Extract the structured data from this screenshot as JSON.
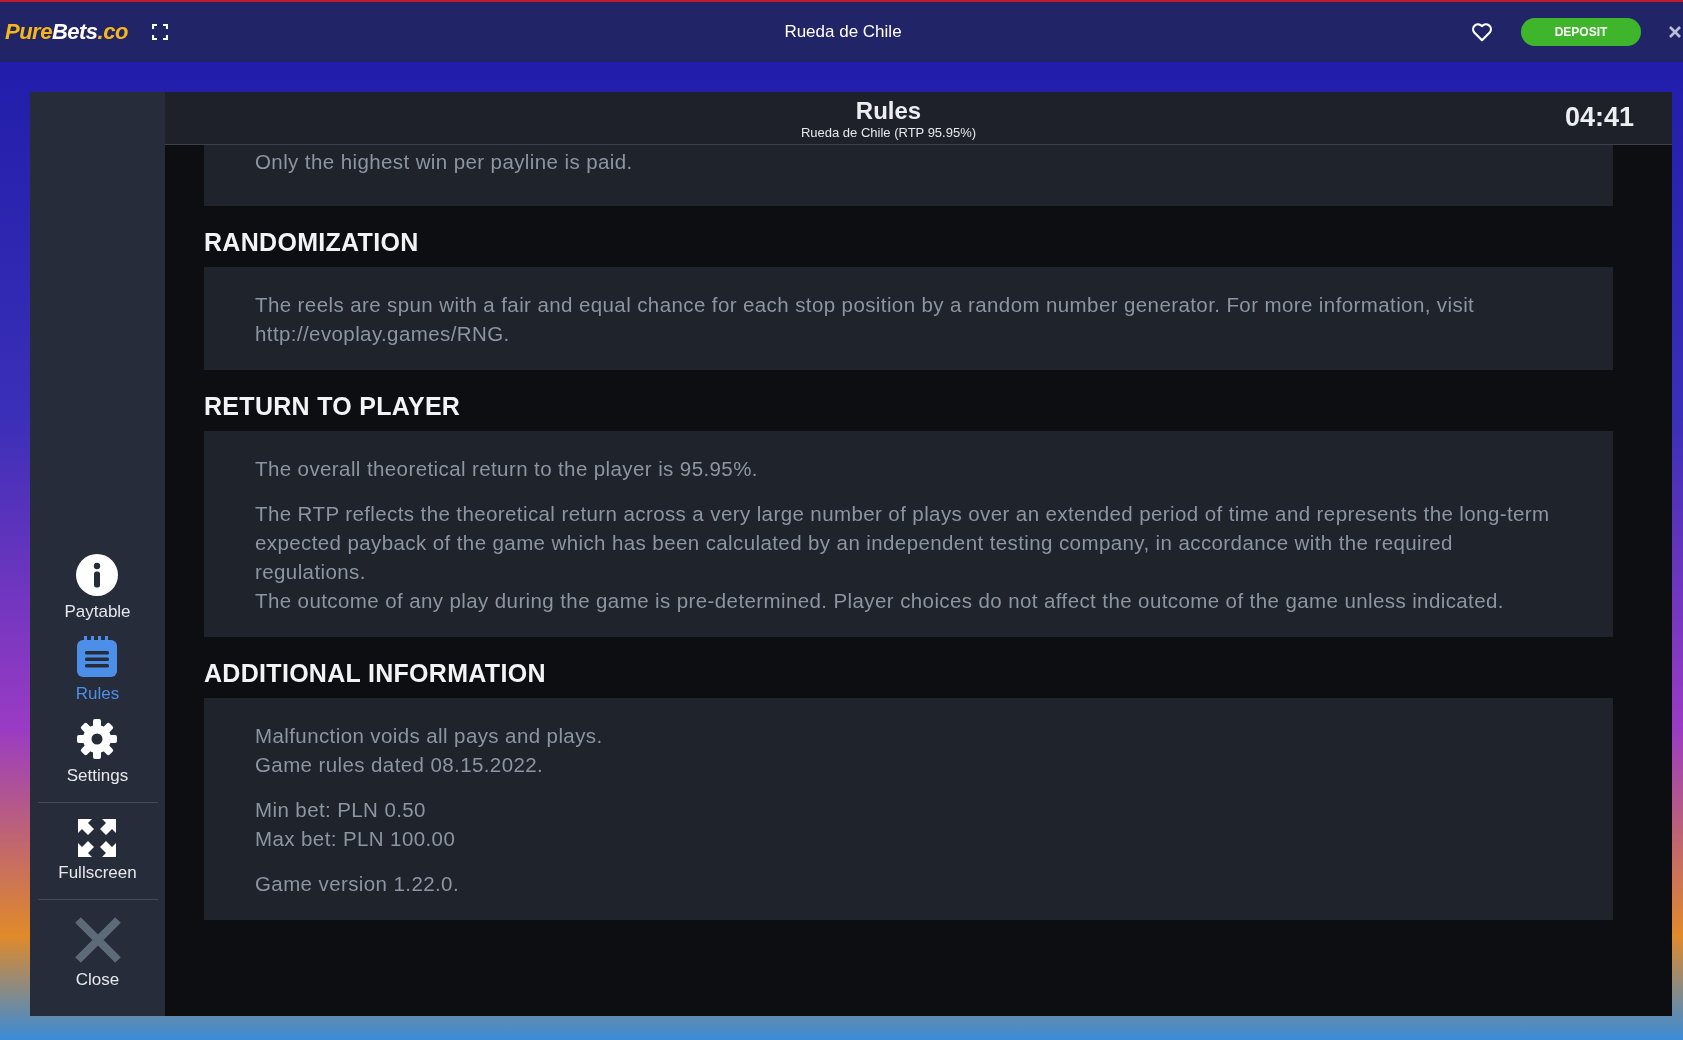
{
  "top_bar": {
    "logo": [
      "Pure",
      "Bets",
      ".co"
    ],
    "title": "Rueda de Chile",
    "deposit": "DEPOSIT"
  },
  "sidebar": {
    "groups": [
      [
        {
          "kind": "info",
          "label": "Paytable",
          "selected": false
        },
        {
          "kind": "rules",
          "label": "Rules",
          "selected": true
        },
        {
          "kind": "settings",
          "label": "Settings",
          "selected": false
        }
      ],
      [
        {
          "kind": "fullscreen",
          "label": "Fullscreen",
          "selected": false
        }
      ],
      [
        {
          "kind": "close",
          "label": "Close",
          "selected": false
        }
      ]
    ]
  },
  "header": {
    "title": "Rules",
    "subtitle": "Rueda de Chile (RTP 95.95%)",
    "timer": "04:41"
  },
  "sections": [
    {
      "blocks": [
        [
          "Only the highest win per payline is paid."
        ]
      ]
    },
    {
      "heading": "RANDOMIZATION",
      "blocks": [
        [
          "The reels are spun with a fair and equal chance for each stop position by a random number generator. For more information, visit http://evoplay.games/RNG."
        ]
      ]
    },
    {
      "heading": "RETURN TO PLAYER",
      "blocks": [
        [
          "The overall theoretical return to the player is 95.95%."
        ],
        [
          "The RTP reflects the theoretical return across a very large number of plays over an extended period of time and represents the long-term expected payback of the game which has been calculated by an independent testing company, in accordance with the required regulations.",
          "The outcome of any play during the game is pre-determined. Player choices do not affect the outcome of the game unless indicated."
        ]
      ]
    },
    {
      "heading": "ADDITIONAL INFORMATION",
      "blocks": [
        [
          "Malfunction voids all pays and plays.",
          "Game rules dated 08.15.2022."
        ],
        [
          "Min bet: PLN 0.50",
          "Max bet: PLN 100.00"
        ],
        [
          "Game version 1.22.0."
        ]
      ]
    }
  ]
}
